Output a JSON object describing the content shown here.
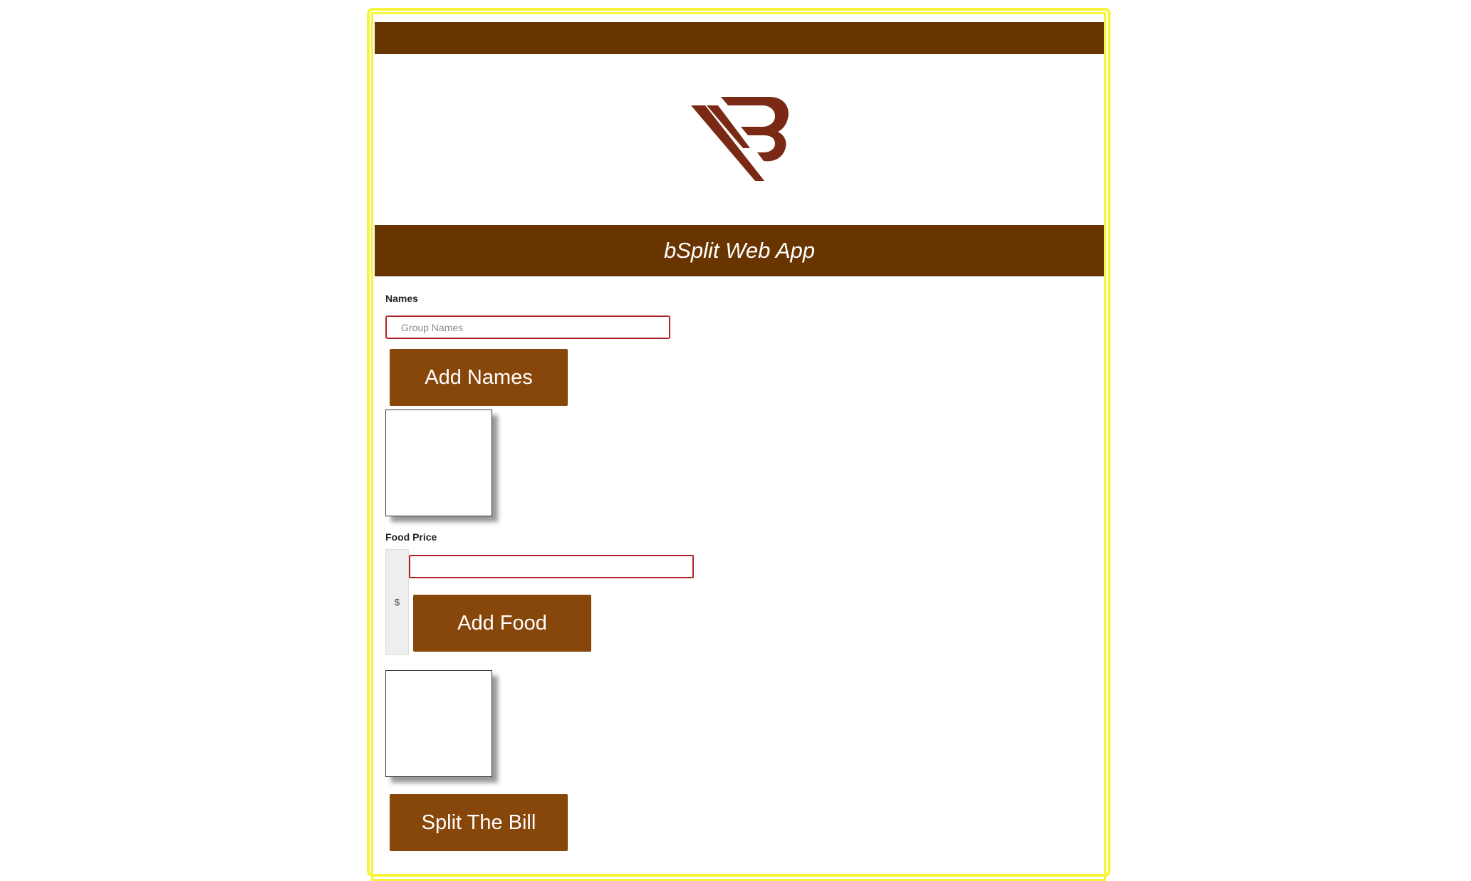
{
  "app": {
    "title": "bSplit Web App"
  },
  "colors": {
    "header_brown": "#683400",
    "button_brown": "#87460a",
    "logo_brown": "#7a2a14",
    "input_border": "#b0242a",
    "frame_yellow": "#f5f53a"
  },
  "logo": {
    "icon": "bsplit-logo-icon"
  },
  "names": {
    "label": "Names",
    "placeholder": "Group Names",
    "value": "",
    "add_button": "Add Names"
  },
  "food": {
    "label": "Food Price",
    "currency": "$",
    "value": "",
    "add_button": "Add Food"
  },
  "actions": {
    "split_button": "Split The Bill"
  }
}
